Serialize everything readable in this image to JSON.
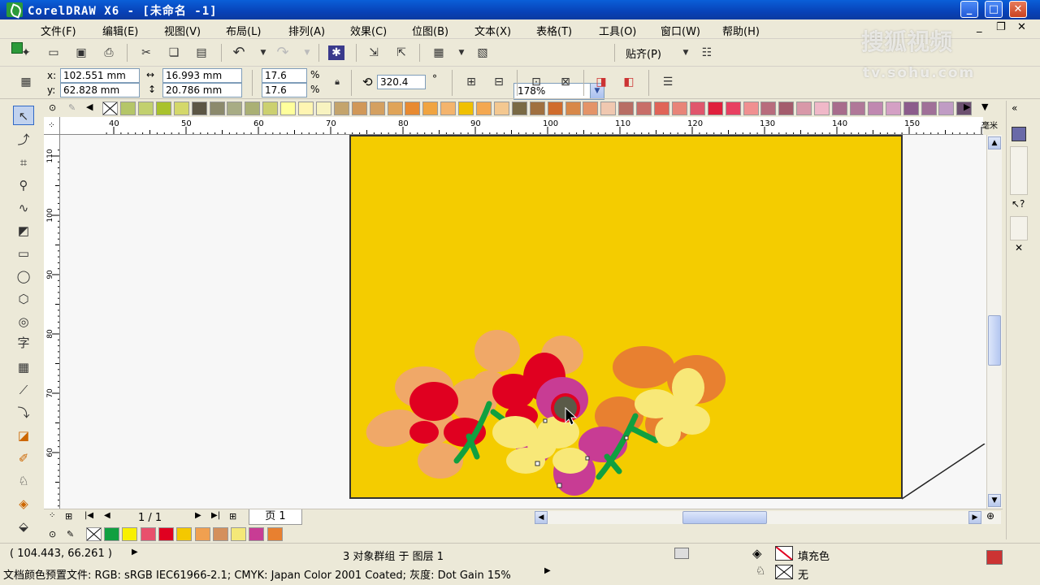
{
  "window": {
    "title": "CorelDRAW X6 - [未命名 -1]"
  },
  "menu": [
    "文件(F)",
    "编辑(E)",
    "视图(V)",
    "布局(L)",
    "排列(A)",
    "效果(C)",
    "位图(B)",
    "文本(X)",
    "表格(T)",
    "工具(O)",
    "窗口(W)",
    "帮助(H)"
  ],
  "toolbar": {
    "zoom": "178%",
    "snap_label": "贴齐(P)"
  },
  "props": {
    "x_label": "x:",
    "x_value": "102.551 mm",
    "y_label": "y:",
    "y_value": "62.828 mm",
    "w_value": "16.993 mm",
    "h_value": "20.786 mm",
    "scale_x": "17.6",
    "scale_y": "17.6",
    "pct": "%",
    "rotation": "320.4",
    "deg": "°"
  },
  "ruler": {
    "h_labels": [
      "40",
      "50",
      "60",
      "70",
      "80",
      "90",
      "100",
      "110",
      "120",
      "130",
      "140",
      "150"
    ],
    "unit": "毫米",
    "v_labels": [
      "110",
      "100",
      "90",
      "80",
      "70",
      "60"
    ]
  },
  "palette": [
    "#b5c668",
    "#c2d06e",
    "#a9c22c",
    "#d4d86a",
    "#5c5644",
    "#8c8a6c",
    "#a8ac84",
    "#aab074",
    "#ccd070",
    "#ffff9c",
    "#fff5b2",
    "#f8f3c0",
    "#c4a46c",
    "#d19858",
    "#d4a060",
    "#e0a458",
    "#e88a30",
    "#f0a440",
    "#f4b46c",
    "#f0c000",
    "#f4a850",
    "#f4c890",
    "#7a6a44",
    "#a07040",
    "#d06c2c",
    "#d88848",
    "#e49468",
    "#f0c8b0",
    "#b86e64",
    "#c86e68",
    "#e06458",
    "#e88478",
    "#e0566c",
    "#e0203c",
    "#e84060",
    "#f09090",
    "#b86c7c",
    "#a45c6c",
    "#d898a8",
    "#f0b8c8",
    "#a86c8c",
    "#b07898",
    "#c088b0",
    "#d4a0c4",
    "#8c5c8c",
    "#a07098",
    "#c09cc4",
    "#6c5070"
  ],
  "nav": {
    "page_count": "1 / 1",
    "page_tab": "页 1"
  },
  "doc_palette": [
    "#10a040",
    "#f8f000",
    "#e8506c",
    "#e00020",
    "#f4c800",
    "#f0a050",
    "#d4905c",
    "#f4e878",
    "#c83c94",
    "#e88030"
  ],
  "status": {
    "coords": "( 104.443, 66.261 )",
    "selection": "3 对象群组 于 图层 1",
    "fill_label": "填充色",
    "outline_label": "无",
    "color_profile": "文档颜色预置文件: RGB: sRGB IEC61966-2.1; CMYK: Japan Color 2001 Coated; 灰度: Dot Gain 15%"
  },
  "watermark": {
    "line1": "搜狐视频",
    "line2": "tv.sohu.com"
  },
  "colors": {
    "page_fill": "#f4cc00",
    "selection_handle": "#333333"
  }
}
